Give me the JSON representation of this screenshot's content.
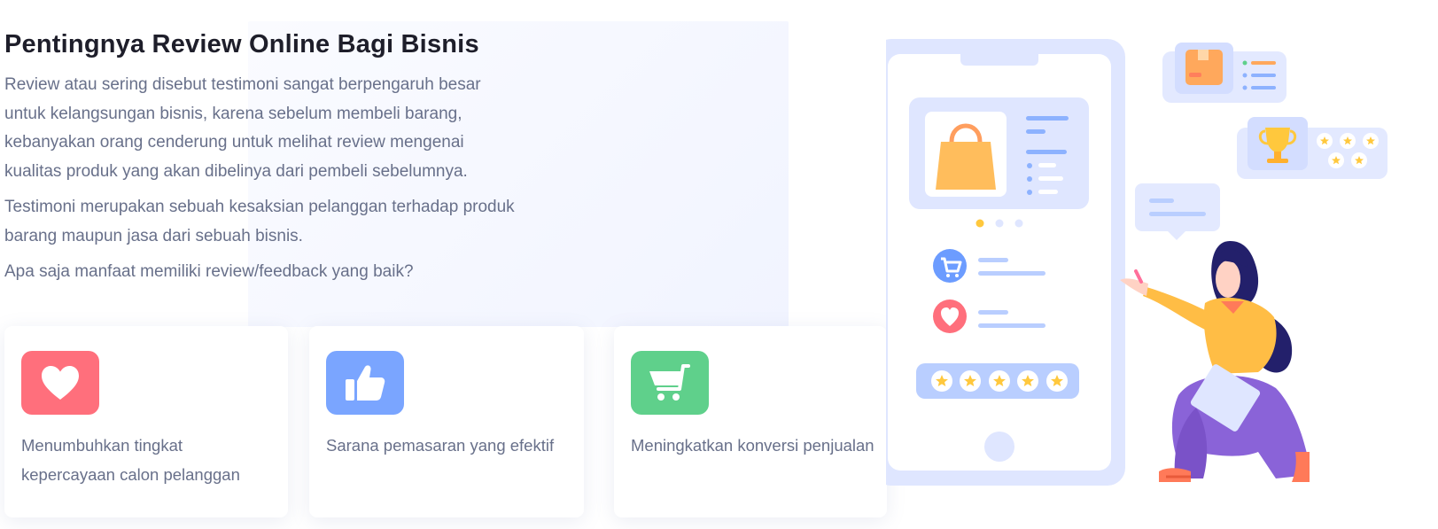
{
  "section": {
    "title": "Pentingnya Review Online Bagi Bisnis",
    "paragraphs": [
      "Review atau sering disebut testimoni sangat berpengaruh besar untuk kelangsungan bisnis, karena sebelum membeli barang, kebanyakan orang cenderung untuk melihat review mengenai kualitas produk yang akan dibelinya dari pembeli sebelumnya.",
      "Testimoni merupakan sebuah kesaksian pelanggan terhadap produk barang maupun jasa dari sebuah bisnis.",
      "Apa saja manfaat memiliki review/feedback yang baik?"
    ]
  },
  "benefits": [
    {
      "icon": "heart-icon",
      "color": "#ff6f7c",
      "label": "Menumbuhkan tingkat kepercayaan calon pelanggan"
    },
    {
      "icon": "thumbs-up-icon",
      "color": "#7aa5ff",
      "label": "Sarana pemasaran yang efektif"
    },
    {
      "icon": "shopping-cart-icon",
      "color": "#5fd08b",
      "label": "Meningkatkan konversi penjualan"
    }
  ],
  "illustration": {
    "rating_stars": 5,
    "colors": {
      "phone": "#dfe6ff",
      "accent_orange": "#ffbd5c",
      "accent_blue": "#8db2ff",
      "star_yellow": "#ffc83d",
      "skirt": "#8a63d8",
      "hair": "#23206b"
    }
  }
}
